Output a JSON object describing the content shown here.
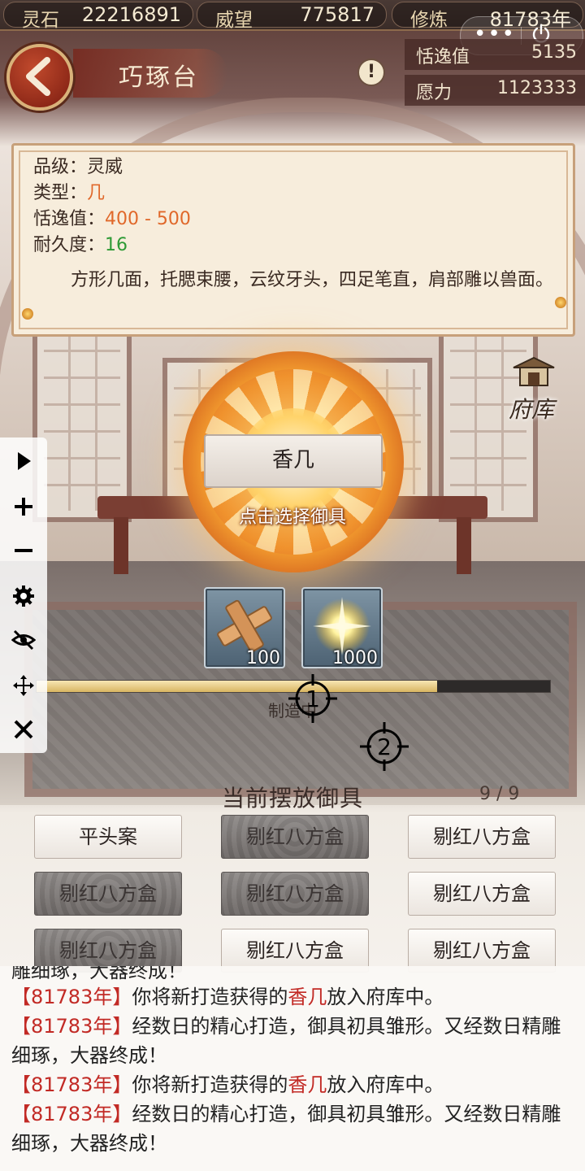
{
  "top_stats": [
    {
      "label": "灵石",
      "value": "22216891"
    },
    {
      "label": "威望",
      "value": "775817"
    },
    {
      "label": "修炼",
      "value": "81783年"
    }
  ],
  "resources": [
    {
      "label": "恬逸值",
      "value": "5135"
    },
    {
      "label": "愿力",
      "value": "1123333"
    }
  ],
  "page_title": "巧琢台",
  "info": {
    "grade_label": "品级：",
    "grade": "灵威",
    "type_label": "类型：",
    "type": "几",
    "comfort_label": "恬逸值：",
    "comfort": "400 - 500",
    "durability_label": "耐久度：",
    "durability": "16",
    "description": "方形几面，托腮束腰，云纹牙头，四足笔直，肩部雕以兽面。"
  },
  "storage_label": "府库",
  "selected_item": "香几",
  "select_tip": "点击选择御具",
  "materials": [
    {
      "icon": "wood-block-icon",
      "count": "100"
    },
    {
      "icon": "spark-light-icon",
      "count": "1000"
    }
  ],
  "progress": {
    "fraction": 0.78,
    "label": "制造中"
  },
  "crosshairs": [
    "1",
    "2"
  ],
  "toolbar": [
    "play-icon",
    "zoom-in-icon",
    "zoom-out-icon",
    "settings-icon",
    "hide-icon",
    "move-icon",
    "close-icon"
  ],
  "placed": {
    "title": "当前摆放御具",
    "count": "9 / 9",
    "items": [
      {
        "label": "平头案",
        "active": true
      },
      {
        "label": "剔红八方盒",
        "active": false
      },
      {
        "label": "剔红八方盒",
        "active": true
      },
      {
        "label": "剔红八方盒",
        "active": false
      },
      {
        "label": "剔红八方盒",
        "active": false
      },
      {
        "label": "剔红八方盒",
        "active": true
      },
      {
        "label": "剔红八方盒",
        "active": false
      },
      {
        "label": "剔红八方盒",
        "active": true
      },
      {
        "label": "剔红八方盒",
        "active": true
      }
    ]
  },
  "log": {
    "cut_line": "雕细琢，大器终成！",
    "entries": [
      {
        "year": "【81783年】",
        "text1": "你将新打造获得的",
        "item": "香几",
        "text2": "放入府库中。"
      },
      {
        "year": "【81783年】",
        "text1": "经数日的精心打造，御具初具雏形。又经数日精雕细琢，大器终成！",
        "item": "",
        "text2": ""
      },
      {
        "year": "【81783年】",
        "text1": "你将新打造获得的",
        "item": "香几",
        "text2": "放入府库中。"
      },
      {
        "year": "【81783年】",
        "text1": "经数日的精心打造，御具初具雏形。又经数日精雕细琢，大器终成！",
        "item": "",
        "text2": ""
      }
    ]
  }
}
